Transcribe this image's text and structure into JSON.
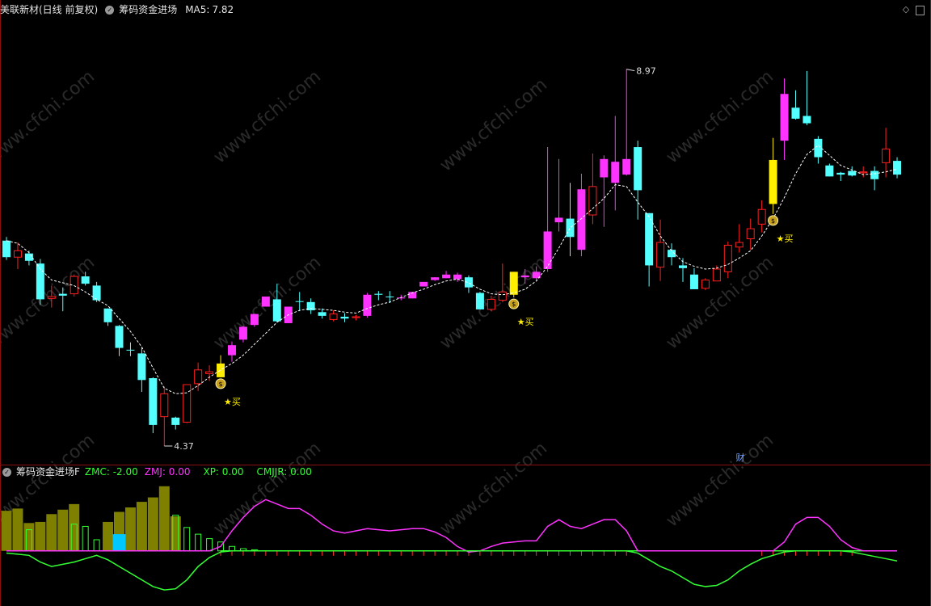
{
  "main_panel": {
    "stock_title": "美联新材(日线 前复权)",
    "indicator_name": "筹码资金进场",
    "ma_label": "MA5:",
    "ma_value": "7.82",
    "high_label": "8.97",
    "low_label": "4.37",
    "buy_label": "★买",
    "finance_marker": "财",
    "watermark": "www.cfchi.com"
  },
  "sub_panel": {
    "title": "筹码资金进场F",
    "zmc_label": "ZMC: -2.00",
    "zmj_label": "ZMJ: 0.00",
    "xp_label": "XP: 0.00",
    "cmjjr_label": "CMJJR: 0.00"
  },
  "colors": {
    "up_candle": "#ff1f1f",
    "down_candle": "#54ffff",
    "strong_candle": "#ff33ff",
    "signal_candle": "#ffee00",
    "ma_line": "#ffffff",
    "volume_bar": "#808000",
    "zmj_line": "#ff33ff",
    "zmc_line": "#33ff33",
    "xp_line": "#33ff33",
    "cmjjr_bar": "#00c8ff",
    "frame": "#8a1010"
  },
  "icons": {
    "settings": "settings-circle-icon",
    "diamond": "diamond-icon",
    "maximize": "maximize-icon",
    "money_bag": "money-bag-icon"
  },
  "chart_data": {
    "type": "candlestick",
    "price_range": [
      4.37,
      8.97
    ],
    "candles": [
      {
        "o": 6.61,
        "c": 6.43,
        "h": 6.65,
        "l": 6.4,
        "k": "d"
      },
      {
        "o": 6.43,
        "c": 6.5,
        "h": 6.59,
        "l": 6.3,
        "k": "u"
      },
      {
        "o": 6.47,
        "c": 6.39,
        "h": 6.5,
        "l": 6.34,
        "k": "d"
      },
      {
        "o": 6.36,
        "c": 5.97,
        "h": 6.41,
        "l": 5.91,
        "k": "d"
      },
      {
        "o": 5.98,
        "c": 6.0,
        "h": 6.12,
        "l": 5.88,
        "k": "u"
      },
      {
        "o": 6.03,
        "c": 6.01,
        "h": 6.1,
        "l": 5.84,
        "k": "d"
      },
      {
        "o": 6.03,
        "c": 6.22,
        "h": 6.24,
        "l": 6.0,
        "k": "u"
      },
      {
        "o": 6.22,
        "c": 6.14,
        "h": 6.27,
        "l": 6.12,
        "k": "d"
      },
      {
        "o": 6.12,
        "c": 5.96,
        "h": 6.16,
        "l": 5.94,
        "k": "d"
      },
      {
        "o": 5.87,
        "c": 5.72,
        "h": 5.87,
        "l": 5.68,
        "k": "d"
      },
      {
        "o": 5.68,
        "c": 5.44,
        "h": 5.69,
        "l": 5.35,
        "k": "d"
      },
      {
        "o": 5.42,
        "c": 5.42,
        "h": 5.5,
        "l": 5.35,
        "k": "d"
      },
      {
        "o": 5.38,
        "c": 5.09,
        "h": 5.44,
        "l": 4.96,
        "k": "d"
      },
      {
        "o": 5.11,
        "c": 4.6,
        "h": 5.12,
        "l": 4.51,
        "k": "d"
      },
      {
        "o": 4.69,
        "c": 4.94,
        "h": 5.02,
        "l": 4.37,
        "k": "u"
      },
      {
        "o": 4.68,
        "c": 4.6,
        "h": 4.69,
        "l": 4.55,
        "k": "d"
      },
      {
        "o": 4.63,
        "c": 5.04,
        "h": 5.04,
        "l": 4.62,
        "k": "u"
      },
      {
        "o": 5.05,
        "c": 5.2,
        "h": 5.28,
        "l": 4.97,
        "k": "u"
      },
      {
        "o": 5.18,
        "c": 5.16,
        "h": 5.25,
        "l": 5.08,
        "k": "u"
      },
      {
        "o": 5.12,
        "c": 5.27,
        "h": 5.36,
        "l": 5.12,
        "k": "y"
      },
      {
        "o": 5.36,
        "c": 5.47,
        "h": 5.51,
        "l": 5.29,
        "k": "m"
      },
      {
        "o": 5.53,
        "c": 5.67,
        "h": 5.68,
        "l": 5.5,
        "k": "m"
      },
      {
        "o": 5.69,
        "c": 5.81,
        "h": 5.81,
        "l": 5.67,
        "k": "m"
      },
      {
        "o": 5.89,
        "c": 6.0,
        "h": 6.0,
        "l": 5.89,
        "k": "m"
      },
      {
        "o": 5.97,
        "c": 5.73,
        "h": 6.14,
        "l": 5.72,
        "k": "d"
      },
      {
        "o": 5.71,
        "c": 5.89,
        "h": 5.89,
        "l": 5.71,
        "k": "m"
      },
      {
        "o": 5.95,
        "c": 5.95,
        "h": 6.05,
        "l": 5.84,
        "k": "d"
      },
      {
        "o": 5.94,
        "c": 5.85,
        "h": 5.98,
        "l": 5.81,
        "k": "d"
      },
      {
        "o": 5.83,
        "c": 5.79,
        "h": 5.87,
        "l": 5.76,
        "k": "d"
      },
      {
        "o": 5.75,
        "c": 5.81,
        "h": 5.85,
        "l": 5.73,
        "k": "u"
      },
      {
        "o": 5.78,
        "c": 5.76,
        "h": 5.82,
        "l": 5.72,
        "k": "d"
      },
      {
        "o": 5.77,
        "c": 5.78,
        "h": 5.8,
        "l": 5.74,
        "k": "u"
      },
      {
        "o": 5.79,
        "c": 6.02,
        "h": 6.04,
        "l": 5.77,
        "k": "m"
      },
      {
        "o": 6.03,
        "c": 6.02,
        "h": 6.06,
        "l": 5.96,
        "k": "d"
      },
      {
        "o": 6.0,
        "c": 6.0,
        "h": 6.06,
        "l": 5.93,
        "k": "d"
      },
      {
        "o": 5.98,
        "c": 5.99,
        "h": 6.02,
        "l": 5.96,
        "k": "m"
      },
      {
        "o": 5.98,
        "c": 6.05,
        "h": 6.05,
        "l": 5.98,
        "k": "m"
      },
      {
        "o": 6.11,
        "c": 6.16,
        "h": 6.16,
        "l": 6.11,
        "k": "m"
      },
      {
        "o": 6.18,
        "c": 6.21,
        "h": 6.21,
        "l": 6.17,
        "k": "m"
      },
      {
        "o": 6.2,
        "c": 6.24,
        "h": 6.28,
        "l": 6.2,
        "k": "m"
      },
      {
        "o": 6.24,
        "c": 6.19,
        "h": 6.26,
        "l": 6.16,
        "k": "m"
      },
      {
        "o": 6.21,
        "c": 6.1,
        "h": 6.23,
        "l": 6.04,
        "k": "d"
      },
      {
        "o": 6.04,
        "c": 5.86,
        "h": 6.05,
        "l": 5.86,
        "k": "d"
      },
      {
        "o": 5.86,
        "c": 5.97,
        "h": 6.01,
        "l": 5.84,
        "k": "u"
      },
      {
        "o": 5.96,
        "c": 6.05,
        "h": 6.36,
        "l": 5.94,
        "k": "u"
      },
      {
        "o": 6.02,
        "c": 6.27,
        "h": 6.27,
        "l": 5.99,
        "k": "y"
      },
      {
        "o": 6.23,
        "c": 6.21,
        "h": 6.3,
        "l": 6.14,
        "k": "m"
      },
      {
        "o": 6.2,
        "c": 6.27,
        "h": 6.33,
        "l": 6.18,
        "k": "m"
      },
      {
        "o": 6.3,
        "c": 6.71,
        "h": 7.63,
        "l": 6.27,
        "k": "m"
      },
      {
        "o": 6.86,
        "c": 6.81,
        "h": 7.5,
        "l": 6.71,
        "k": "m"
      },
      {
        "o": 6.85,
        "c": 6.65,
        "h": 7.24,
        "l": 6.44,
        "k": "d"
      },
      {
        "o": 6.51,
        "c": 7.17,
        "h": 7.34,
        "l": 6.44,
        "k": "m"
      },
      {
        "o": 7.2,
        "c": 6.89,
        "h": 7.56,
        "l": 6.79,
        "k": "u"
      },
      {
        "o": 7.3,
        "c": 7.5,
        "h": 7.54,
        "l": 6.76,
        "k": "m"
      },
      {
        "o": 7.47,
        "c": 7.24,
        "h": 7.97,
        "l": 6.94,
        "k": "m"
      },
      {
        "o": 7.33,
        "c": 7.5,
        "h": 8.48,
        "l": 7.32,
        "k": "m"
      },
      {
        "o": 7.63,
        "c": 7.16,
        "h": 7.7,
        "l": 6.84,
        "k": "d"
      },
      {
        "o": 6.91,
        "c": 6.34,
        "h": 6.91,
        "l": 6.11,
        "k": "d"
      },
      {
        "o": 6.59,
        "c": 6.32,
        "h": 6.84,
        "l": 6.17,
        "k": "u"
      },
      {
        "o": 6.51,
        "c": 6.43,
        "h": 6.58,
        "l": 6.34,
        "k": "d"
      },
      {
        "o": 6.31,
        "c": 6.34,
        "h": 6.42,
        "l": 6.16,
        "k": "d"
      },
      {
        "o": 6.24,
        "c": 6.08,
        "h": 6.31,
        "l": 6.08,
        "k": "d"
      },
      {
        "o": 6.09,
        "c": 6.18,
        "h": 6.2,
        "l": 6.07,
        "k": "u"
      },
      {
        "o": 6.17,
        "c": 6.3,
        "h": 6.34,
        "l": 6.17,
        "k": "u"
      },
      {
        "o": 6.27,
        "c": 6.56,
        "h": 6.6,
        "l": 6.2,
        "k": "u"
      },
      {
        "o": 6.54,
        "c": 6.59,
        "h": 6.79,
        "l": 6.48,
        "k": "u"
      },
      {
        "o": 6.63,
        "c": 6.74,
        "h": 6.85,
        "l": 6.51,
        "k": "u"
      },
      {
        "o": 6.79,
        "c": 6.95,
        "h": 7.05,
        "l": 6.7,
        "k": "u"
      },
      {
        "o": 7.01,
        "c": 7.49,
        "h": 7.73,
        "l": 6.9,
        "k": "y"
      },
      {
        "o": 7.7,
        "c": 8.21,
        "h": 8.38,
        "l": 7.49,
        "k": "m"
      },
      {
        "o": 8.06,
        "c": 7.94,
        "h": 8.25,
        "l": 7.93,
        "k": "d"
      },
      {
        "o": 7.97,
        "c": 7.89,
        "h": 8.46,
        "l": 7.87,
        "k": "d"
      },
      {
        "o": 7.72,
        "c": 7.52,
        "h": 7.75,
        "l": 7.45,
        "k": "d"
      },
      {
        "o": 7.43,
        "c": 7.31,
        "h": 7.45,
        "l": 7.31,
        "k": "d"
      },
      {
        "o": 7.35,
        "c": 7.33,
        "h": 7.36,
        "l": 7.26,
        "k": "d"
      },
      {
        "o": 7.37,
        "c": 7.32,
        "h": 7.42,
        "l": 7.31,
        "k": "d"
      },
      {
        "o": 7.35,
        "c": 7.36,
        "h": 7.42,
        "l": 7.3,
        "k": "u"
      },
      {
        "o": 7.37,
        "c": 7.28,
        "h": 7.42,
        "l": 7.16,
        "k": "d"
      },
      {
        "o": 7.46,
        "c": 7.61,
        "h": 7.84,
        "l": 7.3,
        "k": "u"
      },
      {
        "o": 7.48,
        "c": 7.33,
        "h": 7.52,
        "l": 7.29,
        "k": "d"
      }
    ],
    "ma5": [
      6.61,
      6.58,
      6.48,
      6.3,
      6.18,
      6.15,
      6.12,
      6.05,
      5.97,
      5.9,
      5.76,
      5.62,
      5.45,
      5.22,
      5.0,
      4.94,
      4.95,
      5.03,
      5.12,
      5.2,
      5.27,
      5.36,
      5.48,
      5.6,
      5.72,
      5.8,
      5.85,
      5.87,
      5.86,
      5.85,
      5.83,
      5.82,
      5.87,
      5.91,
      5.94,
      5.99,
      6.04,
      6.08,
      6.13,
      6.17,
      6.19,
      6.15,
      6.08,
      6.03,
      6.02,
      6.04,
      6.08,
      6.17,
      6.33,
      6.53,
      6.75,
      6.85,
      6.96,
      7.07,
      7.22,
      7.2,
      7.03,
      6.87,
      6.66,
      6.5,
      6.38,
      6.33,
      6.3,
      6.31,
      6.35,
      6.42,
      6.5,
      6.66,
      6.85,
      7.08,
      7.34,
      7.55,
      7.65,
      7.54,
      7.43,
      7.38,
      7.33,
      7.34,
      7.36,
      7.39
    ],
    "buy_signals": [
      19,
      45,
      68
    ],
    "sub": {
      "ylim": [
        -2.4,
        3.4
      ],
      "vol_bars": [
        1.8,
        1.9,
        1.25,
        1.3,
        1.65,
        1.85,
        2.1,
        0,
        0,
        1.3,
        1.75,
        1.95,
        2.2,
        2.4,
        2.9,
        1.55
      ],
      "vol_thin": [
        0,
        0,
        0.95,
        0,
        0,
        0,
        1.2,
        1.1,
        0.5,
        0,
        0,
        0,
        0,
        0,
        0,
        1.6,
        1.05,
        0.75,
        0.55,
        0.4,
        0.2,
        0.1,
        0.05
      ],
      "cmjjr_bar": {
        "index": 10,
        "value": 0.75
      },
      "zmj": [
        0,
        0,
        0,
        0,
        0,
        0,
        0,
        0,
        0,
        0,
        0,
        0,
        0,
        0,
        0,
        0,
        0,
        0,
        0,
        0.2,
        0.9,
        1.5,
        2.0,
        2.3,
        2.1,
        1.9,
        1.9,
        1.6,
        1.2,
        0.9,
        0.8,
        0.9,
        1.0,
        0.95,
        0.9,
        0.95,
        1.0,
        1.0,
        0.85,
        0.6,
        0.2,
        -0.05,
        0.0,
        0.2,
        0.35,
        0.4,
        0.45,
        0.45,
        1.1,
        1.4,
        1.1,
        1.0,
        1.2,
        1.4,
        1.4,
        0.9,
        0,
        0,
        0,
        0,
        0,
        0,
        0,
        0,
        0,
        0,
        0,
        0,
        0,
        0.4,
        1.2,
        1.5,
        1.5,
        1.1,
        0.5,
        0.15,
        0,
        0,
        0,
        0
      ],
      "zmc": [
        -0.1,
        -0.15,
        -0.2,
        -0.5,
        -0.7,
        -0.6,
        -0.5,
        -0.35,
        -0.2,
        -0.4,
        -0.7,
        -1.0,
        -1.3,
        -1.6,
        -1.75,
        -1.7,
        -1.3,
        -0.7,
        -0.3,
        -0.05,
        0.0,
        0.0,
        0.0,
        0.0,
        0.0,
        0.0,
        0.0,
        0.0,
        0.0,
        0.0,
        0.0,
        0.0,
        0.0,
        0.0,
        0.0,
        0.0,
        0.0,
        0.0,
        0.0,
        0.0,
        0.0,
        0.0,
        0.0,
        0.0,
        0.0,
        0.0,
        0.0,
        0.0,
        0.0,
        0.0,
        0.0,
        0.0,
        0.0,
        0.0,
        0.0,
        0.0,
        -0.1,
        -0.4,
        -0.7,
        -0.9,
        -1.2,
        -1.5,
        -1.6,
        -1.55,
        -1.3,
        -0.9,
        -0.6,
        -0.35,
        -0.2,
        -0.05,
        0.0,
        0.0,
        0.0,
        0.0,
        0.0,
        -0.05,
        -0.15,
        -0.25,
        -0.35,
        -0.45
      ]
    }
  }
}
